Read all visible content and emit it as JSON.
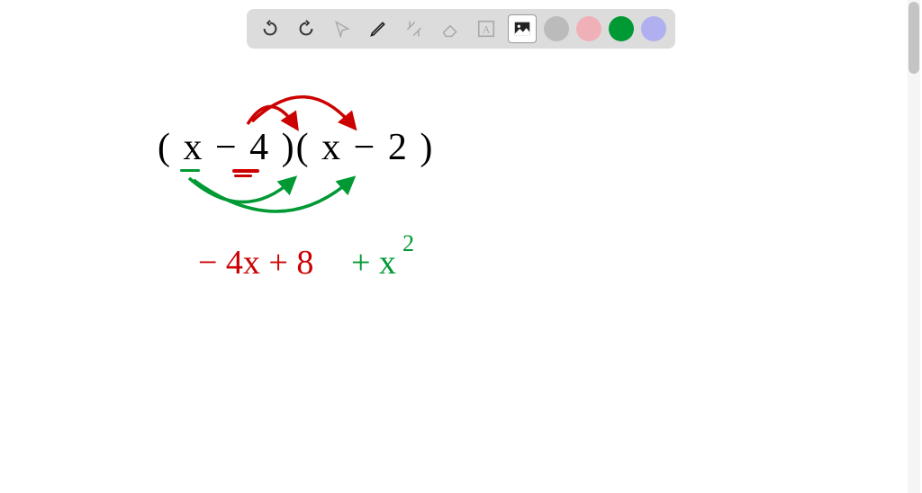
{
  "toolbar": {
    "colors": {
      "gray": "#bbbbbb",
      "pink": "#f0b0b8",
      "green": "#009933",
      "purple": "#b0b0f0"
    }
  },
  "whiteboard": {
    "expression1": "( x − 4 )( x − 2 )",
    "expression2_red": "− 4x + 8",
    "expression2_green": "+ x",
    "expression2_sup": "2",
    "colors": {
      "red": "#cc0000",
      "green": "#009933",
      "black": "#000000"
    }
  }
}
